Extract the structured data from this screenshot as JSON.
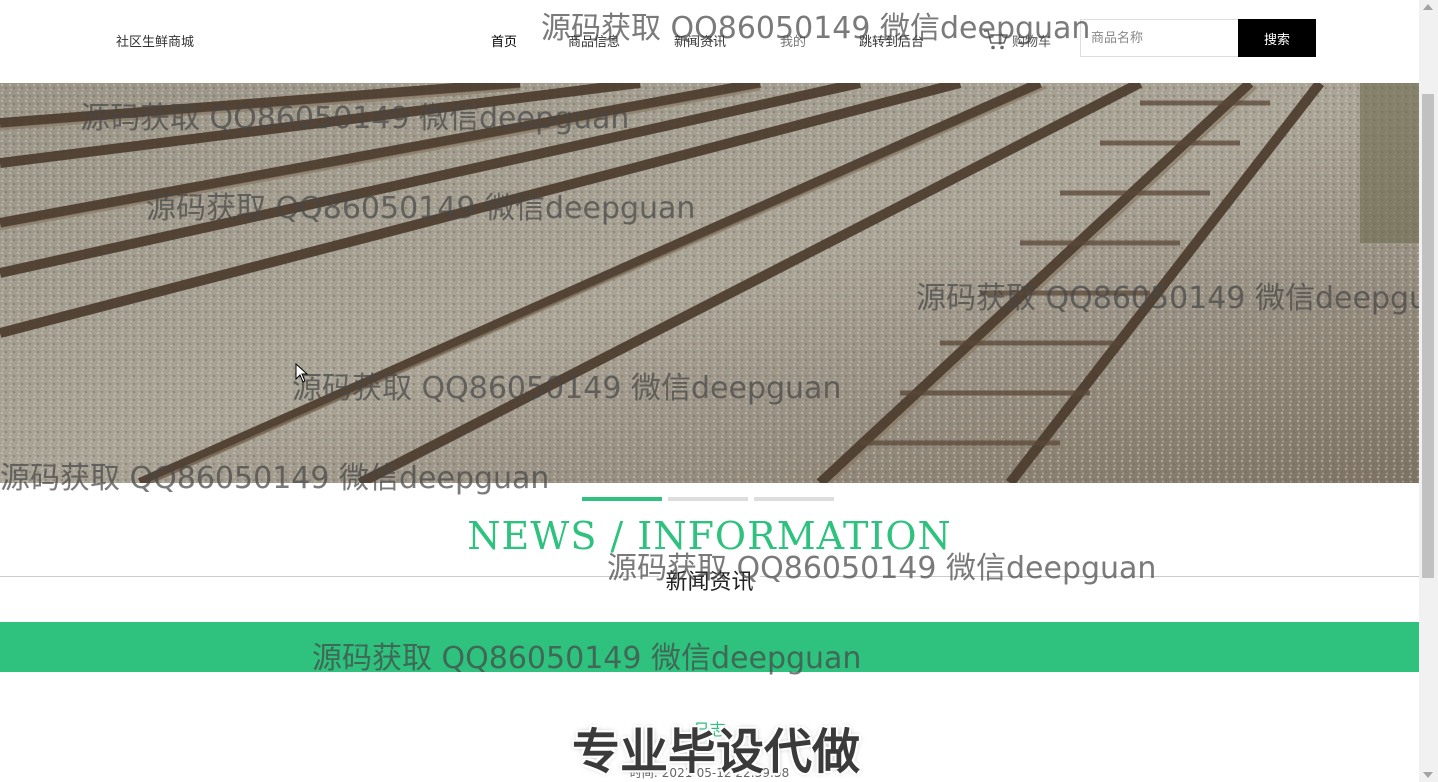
{
  "header": {
    "brand": "社区生鲜商城",
    "nav": [
      {
        "label": "首页"
      },
      {
        "label": "商品信息"
      },
      {
        "label": "新闻资讯"
      },
      {
        "label": "我的"
      },
      {
        "label": "跳转到后台"
      }
    ],
    "cart_label": "购物车",
    "search_placeholder": "商品名称",
    "search_button": "搜索"
  },
  "carousel": {
    "slide_count": 3,
    "active_index": 0
  },
  "section": {
    "title_en": "NEWS / INFORMATION",
    "title_cn": "新闻资讯"
  },
  "news": {
    "title": "日志",
    "time_label": "时间:",
    "time_value": "2021-05-12 22:39:58"
  },
  "overlays": {
    "watermark": "源码获取 QQ86050149 微信deepguan",
    "promo": "专业毕设代做"
  },
  "colors": {
    "accent": "#2ec27e",
    "search_button_bg": "#000000"
  },
  "icons": [
    "cart-icon",
    "cursor-icon"
  ]
}
